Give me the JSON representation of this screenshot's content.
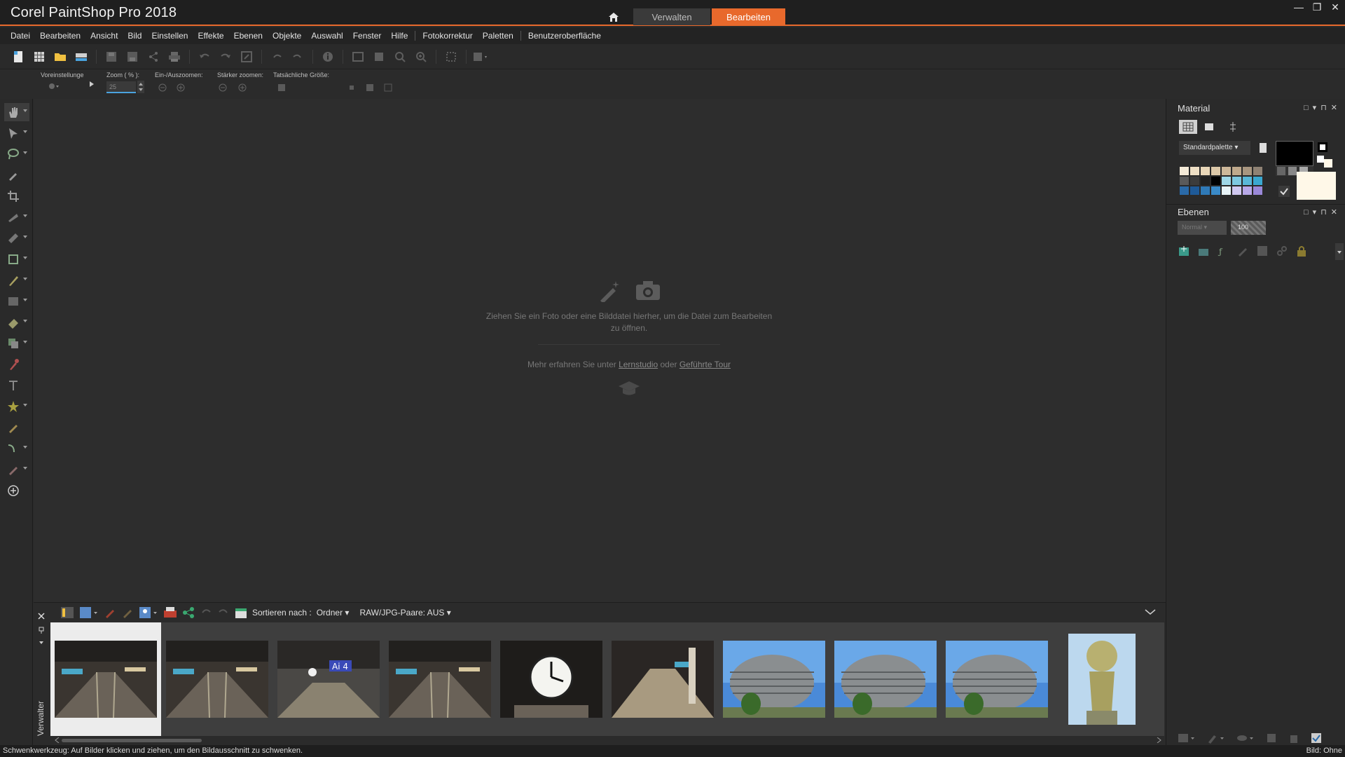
{
  "app": {
    "title": "Corel PaintShop Pro 2018"
  },
  "mode_tabs": {
    "home_icon": "home-icon",
    "manage": "Verwalten",
    "edit": "Bearbeiten",
    "active": "Bearbeiten"
  },
  "window_controls": {
    "minimize": "—",
    "restore": "❐",
    "close": "✕"
  },
  "menu": [
    "Datei",
    "Bearbeiten",
    "Ansicht",
    "Bild",
    "Einstellen",
    "Effekte",
    "Ebenen",
    "Objekte",
    "Auswahl",
    "Fenster",
    "Hilfe",
    "Fotokorrektur",
    "Paletten",
    "Benutzeroberfläche"
  ],
  "tool_options": {
    "preset_label": "Voreinstellunge",
    "zoom_label": "Zoom ( % ):",
    "zoom_value": "25",
    "zoom_in_out_label": "Ein-/Auszoomen:",
    "more_zoom_label": "Stärker zoomen:",
    "actual_size_label": "Tatsächliche Größe:"
  },
  "workspace": {
    "drop_message": "Ziehen Sie ein Foto oder eine Bilddatei hierher, um die Datei zum Bearbeiten zu öffnen.",
    "learn_prefix": "Mehr erfahren Sie unter",
    "learn_link": "Lernstudio",
    "learn_or": "oder",
    "tour_link": "Geführte Tour"
  },
  "material_panel": {
    "title": "Material",
    "palette_dropdown": "Standardpalette",
    "swatch_colors": [
      "#f4ead8",
      "#efe0c6",
      "#e8d6b8",
      "#dcc8a8",
      "#cdb89a",
      "#bfa98c",
      "#a89680",
      "#8f8274",
      "#5a5a5a",
      "#3c3c3c",
      "#202020",
      "#000000",
      "#9fd8e8",
      "#7ec8e0",
      "#5ab8d8",
      "#3aa8d0",
      "#2a6aa8",
      "#1e5a98",
      "#2f7ab8",
      "#3a8ac8",
      "#e8f4f8",
      "#d0c8f0",
      "#b8a8e8",
      "#9a88d8"
    ]
  },
  "layers_panel": {
    "title": "Ebenen",
    "blend_mode": "Normal",
    "opacity": "100"
  },
  "organizer": {
    "sort_label": "Sortieren nach :",
    "sort_value": "Ordner",
    "raw_label": "RAW/JPG-Paare: AUS",
    "side_label": "Verwalter"
  },
  "thumbnails": [
    {
      "kind": "station",
      "selected": true
    },
    {
      "kind": "station",
      "selected": false
    },
    {
      "kind": "station-sign",
      "selected": false,
      "sign": "Ai 4"
    },
    {
      "kind": "station",
      "selected": false
    },
    {
      "kind": "clock",
      "selected": false
    },
    {
      "kind": "station-dark",
      "selected": false
    },
    {
      "kind": "building",
      "selected": false
    },
    {
      "kind": "building",
      "selected": false
    },
    {
      "kind": "building",
      "selected": false
    },
    {
      "kind": "statue",
      "selected": false
    }
  ],
  "status": {
    "message": "Schwenkwerkzeug: Auf Bilder klicken und ziehen, um den Bildausschnitt zu schwenken.",
    "image_info": "Bild: Ohne"
  },
  "colors": {
    "accent": "#e8692c",
    "foreground": "#000000",
    "background": "#fff8e8"
  }
}
